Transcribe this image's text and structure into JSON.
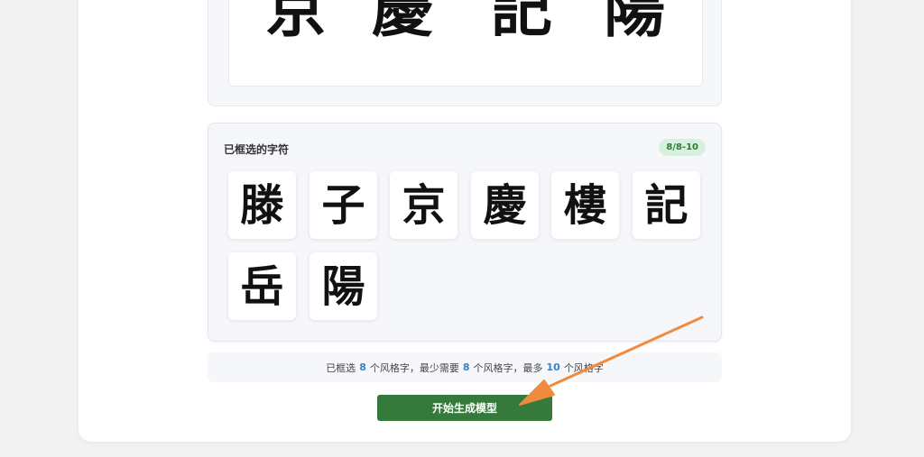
{
  "preview": {
    "glyphs": [
      "京",
      "慶",
      "記",
      "陽"
    ]
  },
  "selected": {
    "title": "已框选的字符",
    "badge": "8/8-10",
    "characters": [
      "滕",
      "子",
      "京",
      "慶",
      "樓",
      "記",
      "岳",
      "陽"
    ]
  },
  "summary": {
    "prefix": "已框选",
    "selected_count": "8",
    "middle1": "个风格字，最少需要",
    "min_count": "8",
    "middle2": "个风格字，最多",
    "max_count": "10",
    "suffix": "个风格字"
  },
  "generate_button": {
    "label": "开始生成模型"
  },
  "colors": {
    "button": "#357a3a",
    "badge_bg": "#d8f0de",
    "badge_text": "#2e7d32",
    "count_highlight": "#3b82c4",
    "arrow": "#f08a3c"
  },
  "icons": {
    "annotation": "arrow-annotation-icon"
  }
}
